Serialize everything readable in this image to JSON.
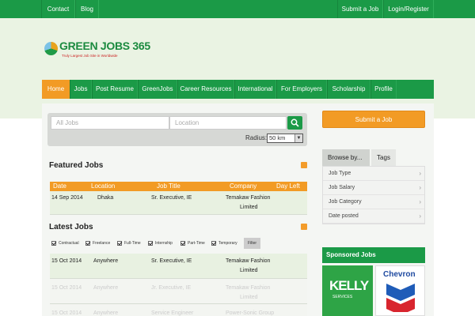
{
  "topbar": {
    "left": [
      "Contact",
      "Blog"
    ],
    "right": [
      "Submit a Job",
      "Login/Register"
    ]
  },
  "logo": {
    "name": "GREEN JOBS 365",
    "tagline": "Truly Largest Job Site in Worldwide"
  },
  "nav": [
    "Home",
    "Jobs",
    "Post Resume",
    "GreenJobs",
    "Career Resources",
    "International",
    "For Employers",
    "Scholarship",
    "Profile"
  ],
  "search": {
    "jobs_placeholder": "All Jobs",
    "location_placeholder": "Location",
    "radius_label": "Radius:",
    "radius_value": "50 km"
  },
  "featured": {
    "title": "Featured Jobs",
    "headers": [
      "Date",
      "Location",
      "Job Title",
      "Company",
      "Day Left"
    ],
    "rows": [
      {
        "date": "14 Sep 2014",
        "location": "Dhaka",
        "title": "Sr. Executive, IE",
        "company_1": "Temakaw Fashion",
        "company_2": "Limited"
      }
    ]
  },
  "latest": {
    "title": "Latest Jobs",
    "filters": [
      "Contractual",
      "Freelance",
      "Full-Time",
      "Internship",
      "Part-Time",
      "Temporary"
    ],
    "filter_button": "Filter",
    "rows": [
      {
        "date": "15 Oct 2014",
        "location": "Anywhere",
        "title": "Sr. Executive, IE",
        "company_1": "Temakaw Fashion",
        "company_2": "Limited"
      },
      {
        "date": "15 Oct 2014",
        "location": "Anywhere",
        "title": "Jr. Executive, IE",
        "company_1": "Temakaw Fashion",
        "company_2": "Limited"
      },
      {
        "date": "15 Oct 2014",
        "location": "Anywhere",
        "title": "Service Engineer",
        "company_1": "Power-Sonic Group",
        "company_2": ""
      }
    ]
  },
  "sidebar": {
    "submit": "Submit a Job",
    "tabs": [
      "Browse by...",
      "Tags"
    ],
    "browse": [
      "Job Type",
      "Job Salary",
      "Job Category",
      "Date posted"
    ],
    "sponsored": "Sponsored Jobs",
    "kelly": "KELLY",
    "kelly_sub": "SERVICES",
    "chevron": "Chevron"
  },
  "colors": {
    "green": "#1b9a47",
    "orange": "#f29b25"
  }
}
